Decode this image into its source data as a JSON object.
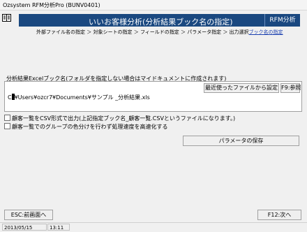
{
  "window": {
    "title": "Ozsystem RFM分析Pro (BUNV0401)"
  },
  "header": {
    "icon": "book-icon",
    "title": "いいお客様分析(分析結果ブック名の指定)",
    "brand": "RFM分析"
  },
  "breadcrumb": {
    "steps": [
      "外部ファイル名の指定",
      "対象シートの指定",
      "フィールドの指定",
      "パラメータ指定",
      "出力選択"
    ],
    "separator": "＞",
    "current": "ブック名の指定"
  },
  "form": {
    "filename_label": "分析結果Excelブック名(フォルダを指定しない場合はマイドキュメントに作成されます)",
    "recent_button": "最近使ったファイルから設定",
    "ref_button": "F9:参照",
    "path_value": "¥Users¥ozcr7¥Documents¥サンプル _分析結果.xls",
    "checkbox_csv": {
      "label": "顧客一覧をCSV形式で出力(上記指定ブック名_顧客一覧.CSVというファイルになります。)",
      "checked": false
    },
    "checkbox_color": {
      "label": "顧客一覧でのグループの色分けを行わず処理速度を高速化する",
      "checked": false
    },
    "save_params_button": "パラメータの保存"
  },
  "footer": {
    "esc_button": "ESC:前画面へ",
    "f12_button": "F12:次へ"
  },
  "statusbar": {
    "date": "2013/05/15",
    "time": "13:11"
  },
  "colors": {
    "header_bg": "#1a4880",
    "link": "#1a3fb0"
  }
}
